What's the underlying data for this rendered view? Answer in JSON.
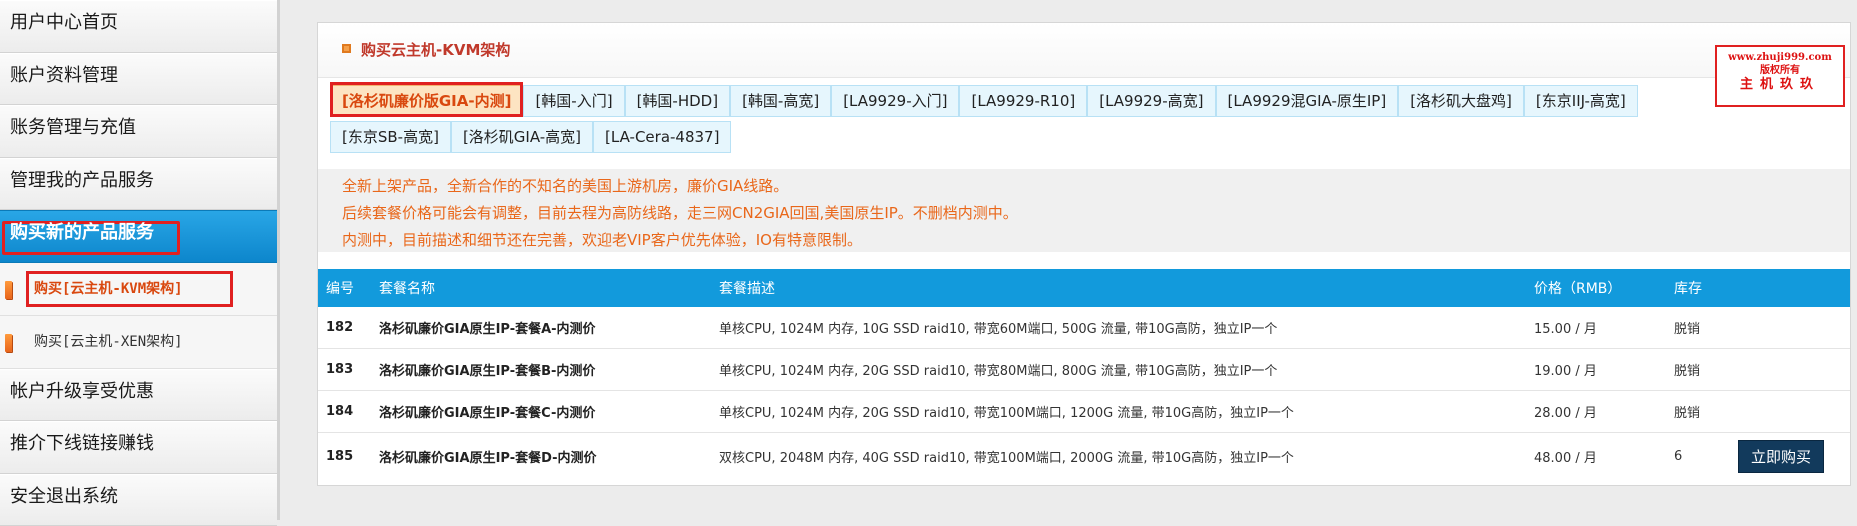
{
  "sidebar": {
    "items": [
      {
        "label": "用户中心首页"
      },
      {
        "label": "账户资料管理"
      },
      {
        "label": "账务管理与充值"
      },
      {
        "label": "管理我的产品服务"
      },
      {
        "label": "购买新的产品服务"
      }
    ],
    "subitems": [
      {
        "label": "购买[云主机-KVM架构]"
      },
      {
        "label": "购买[云主机-XEN架构]"
      }
    ],
    "bottom_items": [
      {
        "label": "帐户升级享受优惠"
      },
      {
        "label": "推介下线链接赚钱"
      },
      {
        "label": "安全退出系统"
      }
    ]
  },
  "panel": {
    "title": "购买云主机-KVM架构"
  },
  "watermark": {
    "line1": "www.zhuji999.com",
    "line2": "版权所有",
    "line3": "主机玖玖"
  },
  "tabs": [
    {
      "label": "[洛杉矶廉价版GIA-内测]"
    },
    {
      "label": "[韩国-入门]"
    },
    {
      "label": "[韩国-HDD]"
    },
    {
      "label": "[韩国-高宽]"
    },
    {
      "label": "[LA9929-入门]"
    },
    {
      "label": "[LA9929-R10]"
    },
    {
      "label": "[LA9929-高宽]"
    },
    {
      "label": "[LA9929混GIA-原生IP]"
    },
    {
      "label": "[洛杉矶大盘鸡]"
    },
    {
      "label": "[东京IIJ-高宽]"
    },
    {
      "label": "[东京SB-高宽]"
    },
    {
      "label": "[洛杉矶GIA-高宽]"
    },
    {
      "label": "[LA-Cera-4837]"
    }
  ],
  "notice": [
    "全新上架产品，全新合作的不知名的美国上游机房，廉价GIA线路。",
    "后续套餐价格可能会有调整，目前去程为高防线路，走三网CN2GIA回国,美国原生IP。不删档内测中。",
    "内测中，目前描述和细节还在完善，欢迎老VIP客户优先体验，IO有特意限制。"
  ],
  "table": {
    "headers": [
      "编号",
      "套餐名称",
      "套餐描述",
      "价格（RMB）",
      "库存",
      ""
    ],
    "rows": [
      {
        "id": "182",
        "name": "洛杉矶廉价GIA原生IP-套餐A-内测价",
        "desc": "单核CPU, 1024M 内存, 10G SSD raid10, 带宽60M端口, 500G 流量, 带10G高防，独立IP一个",
        "price": "15.00 / 月",
        "stock": "脱销"
      },
      {
        "id": "183",
        "name": "洛杉矶廉价GIA原生IP-套餐B-内测价",
        "desc": "单核CPU, 1024M 内存, 20G SSD raid10, 带宽80M端口, 800G 流量, 带10G高防，独立IP一个",
        "price": "19.00 / 月",
        "stock": "脱销"
      },
      {
        "id": "184",
        "name": "洛杉矶廉价GIA原生IP-套餐C-内测价",
        "desc": "单核CPU, 1024M 内存, 20G SSD raid10, 带宽100M端口, 1200G 流量, 带10G高防，独立IP一个",
        "price": "28.00 / 月",
        "stock": "脱销"
      },
      {
        "id": "185",
        "name": "洛杉矶廉价GIA原生IP-套餐D-内测价",
        "desc": "双核CPU, 2048M 内存, 40G SSD raid10, 带宽100M端口, 2000G 流量, 带10G高防，独立IP一个",
        "price": "48.00 / 月",
        "stock": "6",
        "action": "立即购买"
      }
    ]
  }
}
